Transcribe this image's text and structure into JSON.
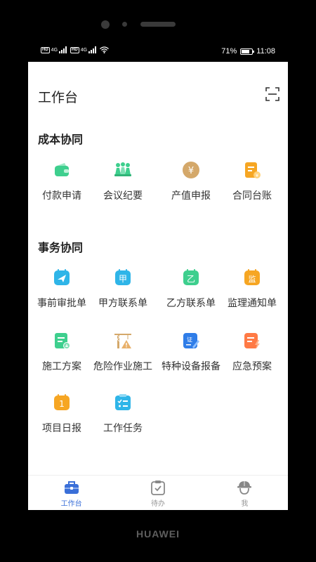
{
  "status_bar": {
    "signal_label_1": "HD",
    "signal_label_2": "4G",
    "battery_percent": "71%",
    "time": "11:08"
  },
  "header": {
    "title": "工作台"
  },
  "sections": [
    {
      "title": "成本协同",
      "items": [
        {
          "label": "付款申请",
          "icon": "wallet-icon"
        },
        {
          "label": "会议纪要",
          "icon": "meeting-icon"
        },
        {
          "label": "产值申报",
          "icon": "yuan-coin-icon"
        },
        {
          "label": "合同台账",
          "icon": "contract-ledger-icon"
        }
      ]
    },
    {
      "title": "事务协同",
      "items": [
        {
          "label": "事前审批单",
          "icon": "send-approval-icon"
        },
        {
          "label": "甲方联系单",
          "icon": "party-a-icon",
          "glyph": "甲"
        },
        {
          "label": "乙方联系单",
          "icon": "party-b-icon",
          "glyph": "乙"
        },
        {
          "label": "监理通知单",
          "icon": "supervision-icon",
          "glyph": "监"
        },
        {
          "label": "施工方案",
          "icon": "construction-plan-icon"
        },
        {
          "label": "危险作业施工",
          "icon": "crane-warning-icon"
        },
        {
          "label": "特种设备报备",
          "icon": "special-equipment-icon"
        },
        {
          "label": "应急预案",
          "icon": "emergency-plan-icon"
        },
        {
          "label": "项目日报",
          "icon": "daily-report-icon",
          "glyph": "1"
        },
        {
          "label": "工作任务",
          "icon": "task-list-icon"
        }
      ]
    }
  ],
  "tabbar": {
    "tabs": [
      {
        "label": "工作台",
        "icon": "briefcase-icon",
        "active": true
      },
      {
        "label": "待办",
        "icon": "clipboard-check-icon",
        "active": false
      },
      {
        "label": "我",
        "icon": "worker-helmet-icon",
        "active": false
      }
    ]
  },
  "device": {
    "brand": "HUAWEI"
  },
  "colors": {
    "active_tab": "#3a6fd8",
    "inactive_tab": "#999999",
    "green": "#3ecf8e",
    "blue": "#2f7de8",
    "orange": "#f6a623",
    "gold": "#d4a86a"
  }
}
